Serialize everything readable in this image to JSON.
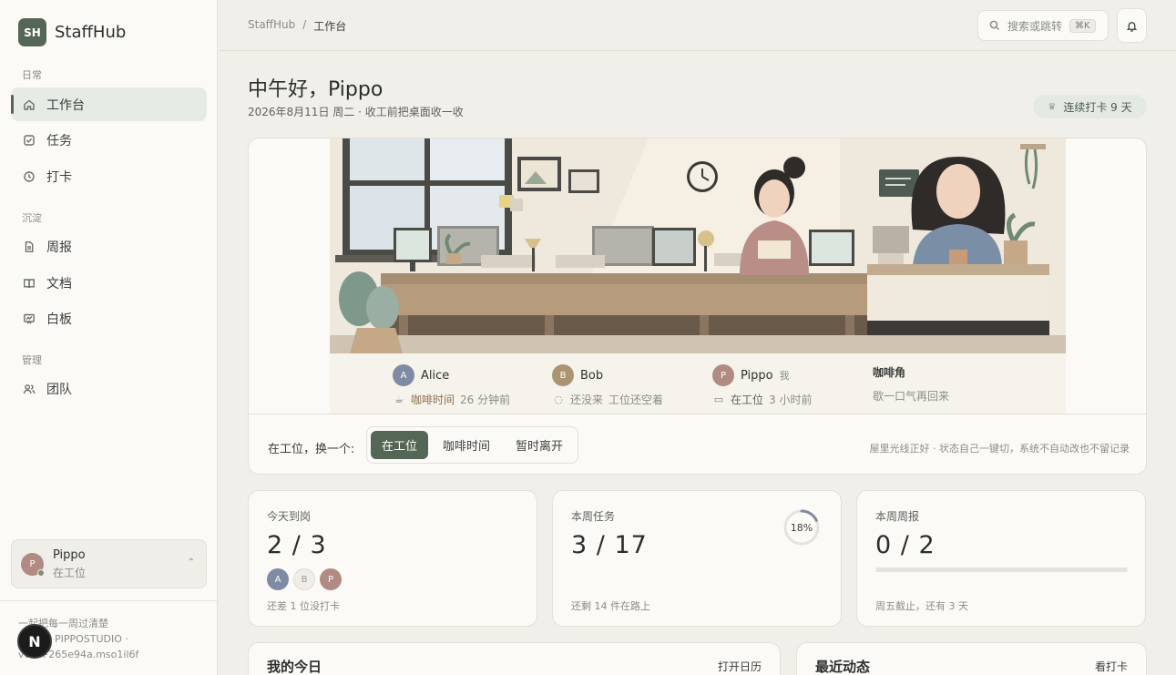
{
  "brand": {
    "logo": "SH",
    "name": "StaffHub"
  },
  "sidebar": {
    "sections": [
      {
        "label": "日常",
        "items": [
          {
            "label": "工作台",
            "icon": "home-icon",
            "active": true
          },
          {
            "label": "任务",
            "icon": "checkbox-icon"
          },
          {
            "label": "打卡",
            "icon": "clock-icon"
          }
        ]
      },
      {
        "label": "沉淀",
        "items": [
          {
            "label": "周报",
            "icon": "document-icon"
          },
          {
            "label": "文档",
            "icon": "book-icon"
          },
          {
            "label": "白板",
            "icon": "whiteboard-icon"
          }
        ]
      },
      {
        "label": "管理",
        "items": [
          {
            "label": "团队",
            "icon": "users-icon"
          }
        ]
      }
    ],
    "user": {
      "initial": "P",
      "name": "Pippo",
      "status": "在工位"
    },
    "footer": {
      "line1": "一起把每一周过清楚",
      "line2": "PIPPOSTUDIO ·",
      "line3": "v0.8+265e94a.mso1il6f"
    },
    "badge": "N"
  },
  "topbar": {
    "breadcrumb": {
      "root": "StaffHub",
      "sep": "/",
      "current": "工作台"
    },
    "search": {
      "placeholder": "搜索或跳转",
      "shortcut": "⌘K"
    }
  },
  "header": {
    "greeting": "中午好，Pippo",
    "date": "2026年8月11日 周二 · 收工前把桌面收一收",
    "streak": "连续打卡 9 天"
  },
  "presence": {
    "people": [
      {
        "initial": "A",
        "name": "Alice",
        "me": "",
        "status": "咖啡时间",
        "detail": "26 分钟前",
        "icon": "coffee-icon",
        "color": "#7f8ba3"
      },
      {
        "initial": "B",
        "name": "Bob",
        "me": "",
        "status": "还没来",
        "detail": "工位还空着",
        "icon": "dashed-circle-icon",
        "color": "#ab9472"
      },
      {
        "initial": "P",
        "name": "Pippo",
        "me": "我",
        "status": "在工位",
        "detail": "3 小时前",
        "icon": "monitor-icon",
        "color": "#b08a83"
      }
    ],
    "coffee_corner": {
      "title": "咖啡角",
      "sub": "歇一口气再回来"
    }
  },
  "switcher": {
    "label": "在工位，换一个:",
    "options": [
      "在工位",
      "咖啡时间",
      "暂时离开"
    ],
    "active": 0,
    "note": "屋里光线正好 · 状态自己一键切，系统不自动改也不留记录"
  },
  "stats": {
    "attendance": {
      "title": "今天到岗",
      "value": "2 / 3",
      "avatars": [
        "A",
        "B",
        "P"
      ],
      "foot": "还差 1 位没打卡"
    },
    "tasks": {
      "title": "本周任务",
      "value": "3 / 17",
      "percent": "18%",
      "percent_value": 0.18,
      "foot": "还剩 14 件在路上"
    },
    "reports": {
      "title": "本周周报",
      "value": "0 / 2",
      "progress": 0,
      "foot": "周五截止，还有 3 天"
    }
  },
  "bottom": {
    "today": {
      "title": "我的今日",
      "link": "打开日历"
    },
    "activity": {
      "title": "最近动态",
      "link": "看打卡"
    }
  }
}
